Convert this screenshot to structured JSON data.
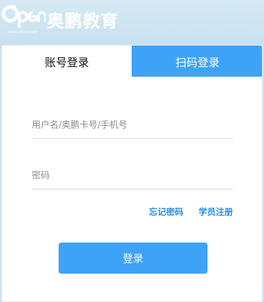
{
  "brand": {
    "logo_text": "Open",
    "logo_subtext": "OPEN EDUCATION",
    "name": "奥鹏教育"
  },
  "tabs": [
    {
      "label": "账号登录",
      "active": true
    },
    {
      "label": "扫码登录",
      "active": false
    }
  ],
  "form": {
    "username_placeholder": "用户名/奥鹏卡号/手机号",
    "username_value": "",
    "password_placeholder": "密码",
    "password_value": ""
  },
  "links": {
    "forgot_password": "忘记密码",
    "register": "学员注册"
  },
  "login_button": "登录",
  "colors": {
    "accent": "#3ea3f6",
    "link": "#2a8fe0",
    "background": "#cfe3f0"
  }
}
